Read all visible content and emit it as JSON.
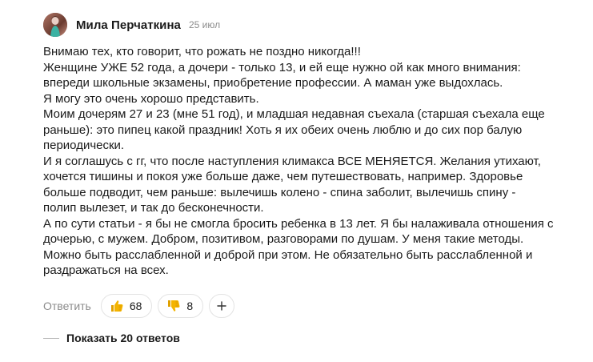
{
  "comment": {
    "author": "Мила Перчаткина",
    "date": "25 июл",
    "paragraphs": [
      "Внимаю тех, кто говорит, что рожать не поздно никогда!!!",
      "Женщине УЖЕ 52 года, а дочери - только 13, и ей еще нужно ой как много внимания:",
      "впереди школьные экзамены, приобретение профессии. А маман уже выдохлась.",
      "Я могу это очень хорошо представить.",
      "Моим дочерям 27 и 23 (мне 51 год), и младшая недавная съехала (старшая съехала еще",
      "раньше): это пипец какой праздник! Хоть я их обеих очень люблю и до сих пор балую",
      "периодически.",
      "И я соглашусь с гг, что после наступления климакса ВСЕ МЕНЯЕТСЯ. Желания утихают,",
      "хочется тишины и покоя уже больше даже, чем путешествовать, например. Здоровье",
      "больше подводит, чем раньше: вылечишь колено - спина заболит, вылечишь спину -",
      "полип вылезет, и так до бесконечности.",
      "А по сути статьи - я бы не смогла бросить ребенка в 13 лет. Я бы налаживала отношения с",
      "дочерью, с мужем. Добром, позитивом, разговорами по душам. У меня такие методы.",
      "Можно быть расслабленной и доброй при этом. Не обязательно быть расслабленной и",
      "раздражаться на всех."
    ]
  },
  "actions": {
    "reply_label": "Ответить",
    "like_icon": "thumbs-up-icon",
    "like_count": "68",
    "dislike_icon": "thumbs-down-icon",
    "dislike_count": "8",
    "add_reaction_icon": "plus-icon"
  },
  "replies": {
    "show_label": "Показать 20 ответов"
  },
  "colors": {
    "muted_text": "#8c8c8c",
    "border": "#e3e3e3",
    "reaction_yellow": "#f4b400"
  }
}
